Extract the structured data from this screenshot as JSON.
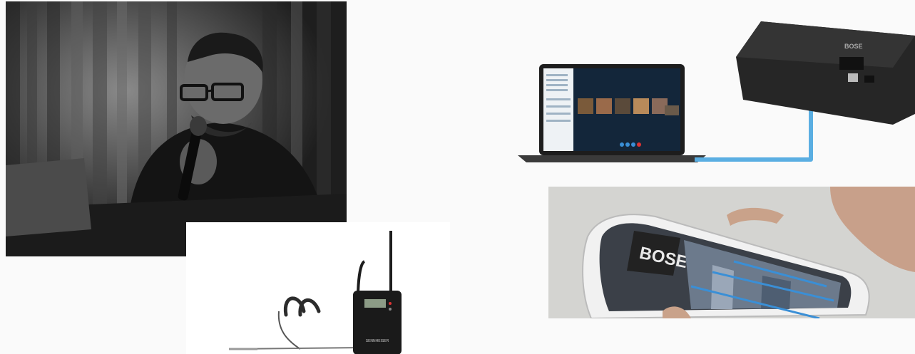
{
  "images": {
    "speaker": {
      "label": "Black-and-white photo of a man with glasses speaking into a handheld microphone",
      "icon": "speaker-photo"
    },
    "bodypack": {
      "label": "Wireless bodypack transmitter with headset microphone",
      "icon": "bodypack-photo",
      "brand_text": "SENNHEISER"
    },
    "laptop_diagram": {
      "label": "Laptop running a video call connected by cable to a conferencing interface box",
      "icon": "laptop-connection-diagram",
      "device_brand": "BOSE",
      "accent_color": "#5aaee2"
    },
    "phone": {
      "label": "Hand holding a smartphone showing a configuration app",
      "icon": "phone-app-photo",
      "app_brand": "BOSE"
    }
  }
}
